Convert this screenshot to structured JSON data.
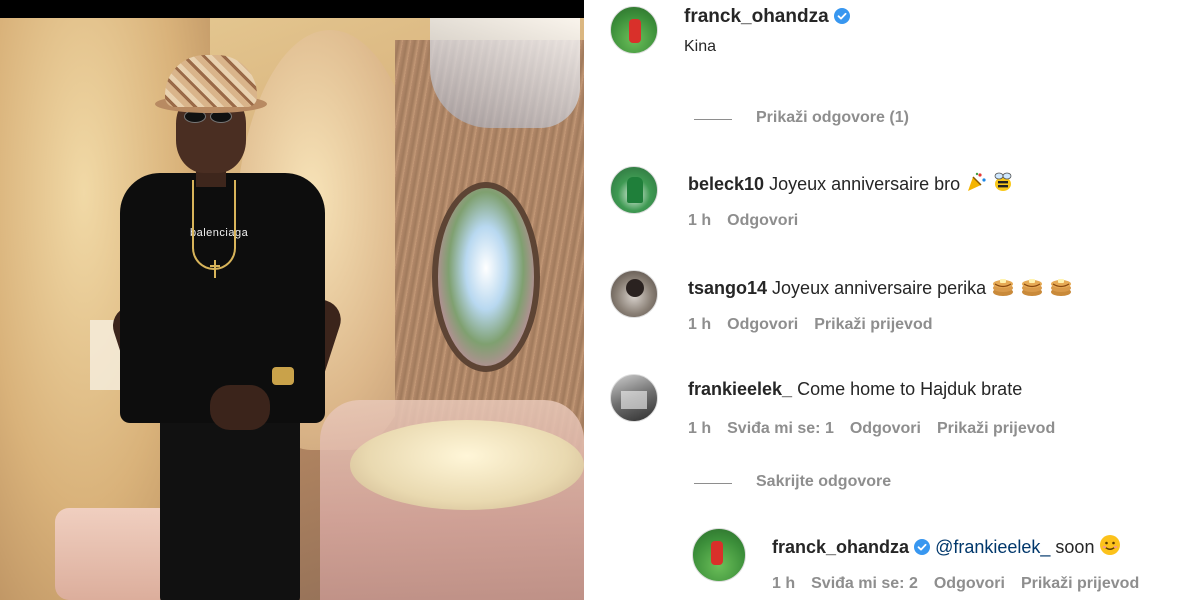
{
  "post": {
    "author": "franck_ohandza",
    "caption": "Kina",
    "photo_shirt_text": "balenciaga"
  },
  "threads": {
    "show_replies_label": "Prikaži odgovore (1)",
    "hide_replies_label": "Sakrijte odgovore"
  },
  "comments": [
    {
      "username": "beleck10",
      "text": "Joyeux anniversaire bro",
      "emojis": [
        "party-popper",
        "bee"
      ],
      "time": "1 h",
      "reply_label": "Odgovori"
    },
    {
      "username": "tsango14",
      "text": "Joyeux anniversaire perika",
      "emojis": [
        "pancakes",
        "pancakes",
        "pancakes"
      ],
      "time": "1 h",
      "reply_label": "Odgovori",
      "translate_label": "Prikaži prijevod"
    },
    {
      "username": "frankieelek_",
      "text": "Come home to Hajduk brate",
      "time": "1 h",
      "likes_label": "Sviđa mi se: 1",
      "reply_label": "Odgovori",
      "translate_label": "Prikaži prijevod"
    }
  ],
  "reply": {
    "username": "franck_ohandza",
    "mention": "@frankieelek_",
    "text": "soon",
    "emojis": [
      "smiling-face"
    ],
    "time": "1 h",
    "likes_label": "Sviđa mi se: 2",
    "reply_label": "Odgovori",
    "translate_label": "Prikaži prijevod"
  },
  "colors": {
    "verified_blue": "#3897f0",
    "meta_grey": "#8e8e8e",
    "text_dark": "#262626",
    "mention_blue": "#00376b"
  }
}
